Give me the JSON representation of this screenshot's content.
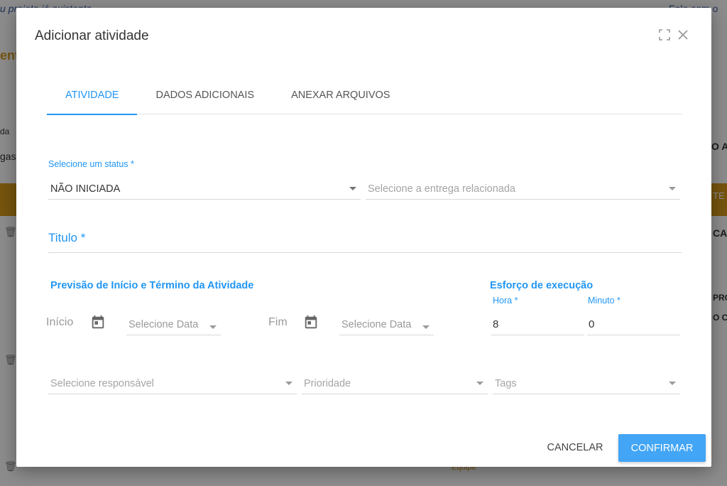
{
  "background": {
    "top_left_text": "u projeto já existente",
    "top_right_text": "Fale com o",
    "left_fragments": [
      "ent",
      "da",
      "gas"
    ],
    "right_fragments": [
      "O A",
      "TE D",
      "CAt",
      "PRO",
      "O CO"
    ],
    "bottom_label": "Equipe"
  },
  "modal": {
    "title": "Adicionar atividade",
    "expand_icon": "fullscreen-icon",
    "close_icon": "close-icon",
    "tabs": [
      {
        "label": "Atividade",
        "active": true
      },
      {
        "label": "Dados adicionais",
        "active": false
      },
      {
        "label": "Anexar arquivos",
        "active": false
      }
    ],
    "status": {
      "label": "Selecione um status",
      "required_mark": "*",
      "value": "NÃO INICIADA"
    },
    "delivery": {
      "placeholder": "Selecione a entrega relacionada"
    },
    "titulo": {
      "label": "Titulo",
      "required_mark": "*"
    },
    "schedule": {
      "section_title": "Previsão de Início e Término da Atividade",
      "start_label": "Início",
      "start_placeholder": "Selecione Data",
      "end_label": "Fim",
      "end_placeholder": "Selecione Data"
    },
    "effort": {
      "section_title": "Esforço de execução",
      "hours_label": "Hora",
      "hours_required": "*",
      "hours_value": "8",
      "minutes_label": "Minuto",
      "minutes_required": "*",
      "minutes_value": "0"
    },
    "responsible": {
      "placeholder": "Selecione responsável"
    },
    "priority": {
      "placeholder": "Prioridade"
    },
    "tags": {
      "placeholder": "Tags"
    },
    "buttons": {
      "cancel": "Cancelar",
      "confirm": "Confirmar"
    }
  },
  "colors": {
    "accent": "#2196f3",
    "confirm_bg": "#42a5f5",
    "bg_orange": "#d89a1a"
  }
}
